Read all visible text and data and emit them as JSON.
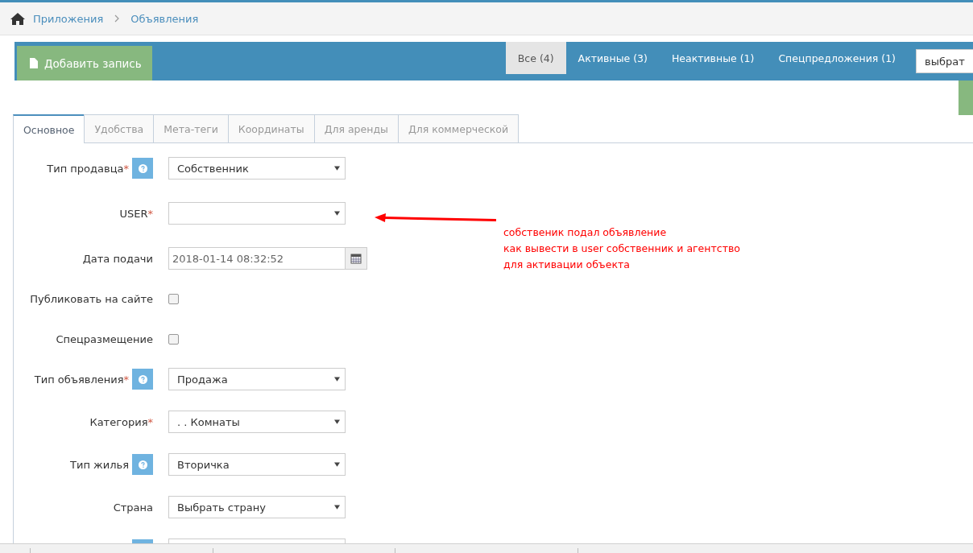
{
  "breadcrumb": [
    "Приложения",
    "Объявления"
  ],
  "toolbar": {
    "add_button": "Добавить запись",
    "filters": [
      {
        "label": "Все (4)",
        "selected": true
      },
      {
        "label": "Активные (3)",
        "selected": false
      },
      {
        "label": "Неактивные (1)",
        "selected": false
      },
      {
        "label": "Спецпредложения (1)",
        "selected": false
      }
    ],
    "select_value": "выбрат"
  },
  "tabs": [
    {
      "label": "Основное",
      "selected": true
    },
    {
      "label": "Удобства",
      "selected": false
    },
    {
      "label": "Мета-теги",
      "selected": false
    },
    {
      "label": "Координаты",
      "selected": false
    },
    {
      "label": "Для аренды",
      "selected": false
    },
    {
      "label": "Для коммерческой",
      "selected": false
    }
  ],
  "fields": [
    {
      "kind": "select",
      "label": "Тип продавца",
      "required": true,
      "help": true,
      "value": "Собственник"
    },
    {
      "kind": "select",
      "label": "USER",
      "required": true,
      "help": false
    },
    {
      "kind": "date",
      "label": "Дата подачи",
      "required": false,
      "help": false,
      "value": "2018-01-14 08:32:52"
    },
    {
      "kind": "checkbox",
      "label": "Публиковать на сайте",
      "required": false,
      "help": false,
      "checked": false
    },
    {
      "kind": "checkbox",
      "label": "Спецразмещение",
      "required": false,
      "help": false,
      "checked": false
    },
    {
      "kind": "select",
      "label": "Тип объявления",
      "required": true,
      "help": true,
      "value": "Продажа"
    },
    {
      "kind": "select",
      "label": "Категория",
      "required": true,
      "help": false,
      "value": ". . Комнаты"
    },
    {
      "kind": "select",
      "label": "Тип жилья",
      "required": false,
      "help": true,
      "value": "Вторичка"
    },
    {
      "kind": "select",
      "label": "Страна",
      "required": false,
      "help": false,
      "value": "Выбрать страну"
    },
    {
      "kind": "select",
      "help": true
    }
  ],
  "required_mark": "*",
  "annotation": [
    "собственик подал объявление",
    "как вывести в user собственник и агентство",
    "для активации объекта"
  ]
}
